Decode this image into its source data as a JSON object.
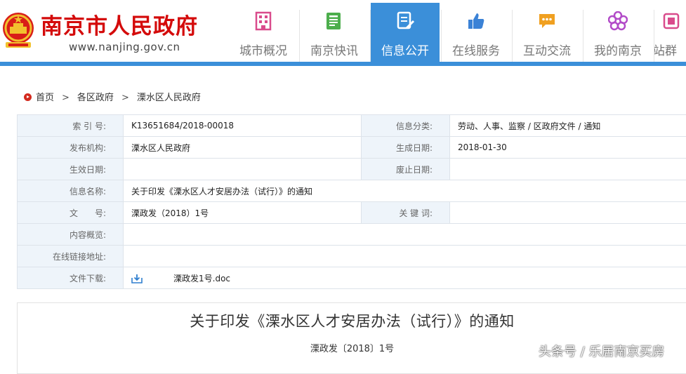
{
  "header": {
    "site_name": "南京市人民政府",
    "site_url": "www.nanjing.gov.cn",
    "nav": [
      {
        "label": "城市概况",
        "icon": "building-icon",
        "color": "#d94b8c"
      },
      {
        "label": "南京快讯",
        "icon": "newspaper-icon",
        "color": "#4cae4c"
      },
      {
        "label": "信息公开",
        "icon": "document-edit-icon",
        "color": "#ffffff",
        "active": true
      },
      {
        "label": "在线服务",
        "icon": "thumbs-up-icon",
        "color": "#3b82d6"
      },
      {
        "label": "互动交流",
        "icon": "chat-bubble-icon",
        "color": "#f0a020"
      },
      {
        "label": "我的南京",
        "icon": "plum-blossom-icon",
        "color": "#b24bc8"
      },
      {
        "label": "站群",
        "icon": "sites-icon",
        "color": "#d94b8c"
      }
    ],
    "accent": "#3b8fd9"
  },
  "breadcrumb": {
    "items": [
      "首页",
      "各区政府",
      "溧水区人民政府"
    ],
    "separator": ">"
  },
  "info": {
    "index_label": "索 引 号:",
    "index_value": "K13651684/2018-00018",
    "category_label": "信息分类:",
    "category_value": "劳动、人事、监察 / 区政府文件 / 通知",
    "publisher_label": "发布机构:",
    "publisher_value": "溧水区人民政府",
    "created_label": "生成日期:",
    "created_value": "2018-01-30",
    "effective_label": "生效日期:",
    "effective_value": "",
    "expire_label": "废止日期:",
    "expire_value": "",
    "name_label": "信息名称:",
    "name_value": "关于印发《溧水区人才安居办法（试行）》的通知",
    "docno_label": "文　　号:",
    "docno_value": "溧政发（2018）1号",
    "keywords_label": "关 键 词:",
    "keywords_value": "",
    "summary_label": "内容概览:",
    "summary_value": "",
    "link_label": "在线链接地址:",
    "link_value": "",
    "download_label": "文件下载:",
    "download_file": "溧政发1号.doc"
  },
  "document": {
    "title": "关于印发《溧水区人才安居办法（试行）》的通知",
    "number": "溧政发〔2018〕1号"
  },
  "watermark": "头条号 / 乐居南京买房"
}
